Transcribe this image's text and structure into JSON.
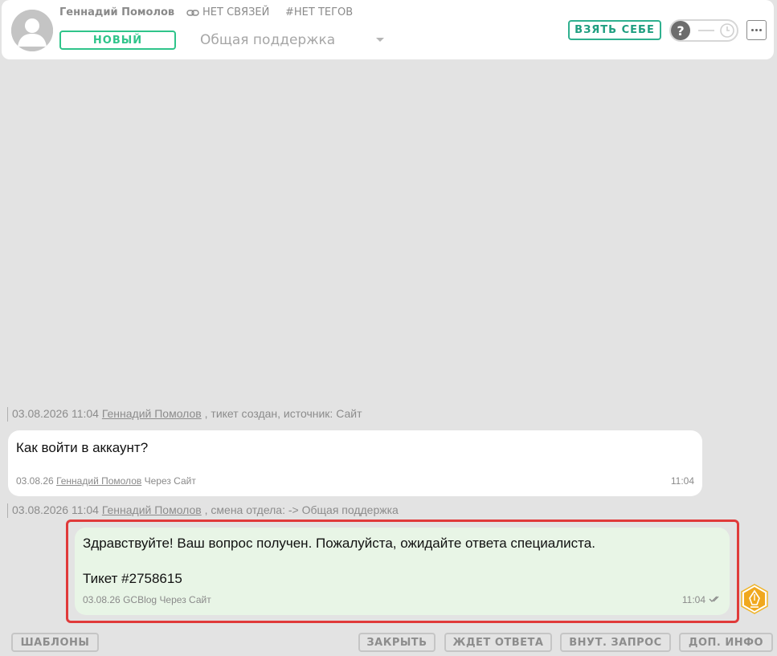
{
  "header": {
    "user_name": "Геннадий Помолов",
    "links_label": "НЕТ СВЯЗЕЙ",
    "tags_label": "#НЕТ ТЕГОВ",
    "status_badge": "НОВЫЙ",
    "department": "Общая поддержка",
    "take_button": "ВЗЯТЬ СЕБЕ",
    "toggle_knob": "?",
    "status_color": "#2fc48a",
    "accent_color": "#1f9e80"
  },
  "events": [
    {
      "datetime": "03.08.2026 11:04",
      "author": "Геннадий Помолов",
      "text": ", тикет создан, источник: Сайт"
    },
    {
      "datetime": "03.08.2026 11:04",
      "author": "Геннадий Помолов",
      "text": ", смена отдела: -> Общая поддержка"
    }
  ],
  "messages": [
    {
      "text": "Как войти в аккаунт?",
      "date": "03.08.26",
      "author": "Геннадий Помолов",
      "via": "Через Сайт",
      "time": "11:04"
    },
    {
      "line1": "Здравствуйте! Ваш вопрос получен. Пожалуйста, ожидайте ответа специалиста.",
      "line2": "Тикет #2758615",
      "date": "03.08.26",
      "author": "GCBlog",
      "via": "Через Сайт",
      "time": "11:04",
      "highlight_color": "#e03a3a",
      "bubble_color": "#e8f5e6"
    }
  ],
  "bottom_bar": {
    "templates": "ШАБЛОНЫ",
    "close": "ЗАКРЫТЬ",
    "awaiting_reply": "ЖДЕТ ОТВЕТА",
    "internal_request": "ВНУТ. ЗАПРОС",
    "extra_info": "ДОП. ИНФО"
  },
  "icons": {
    "avatar": "user-silhouette-icon",
    "links": "link-icon",
    "clock": "clock-icon",
    "more": "more-dots-icon",
    "read": "double-check-icon",
    "bot": "pen-nib-hexagon-icon"
  }
}
